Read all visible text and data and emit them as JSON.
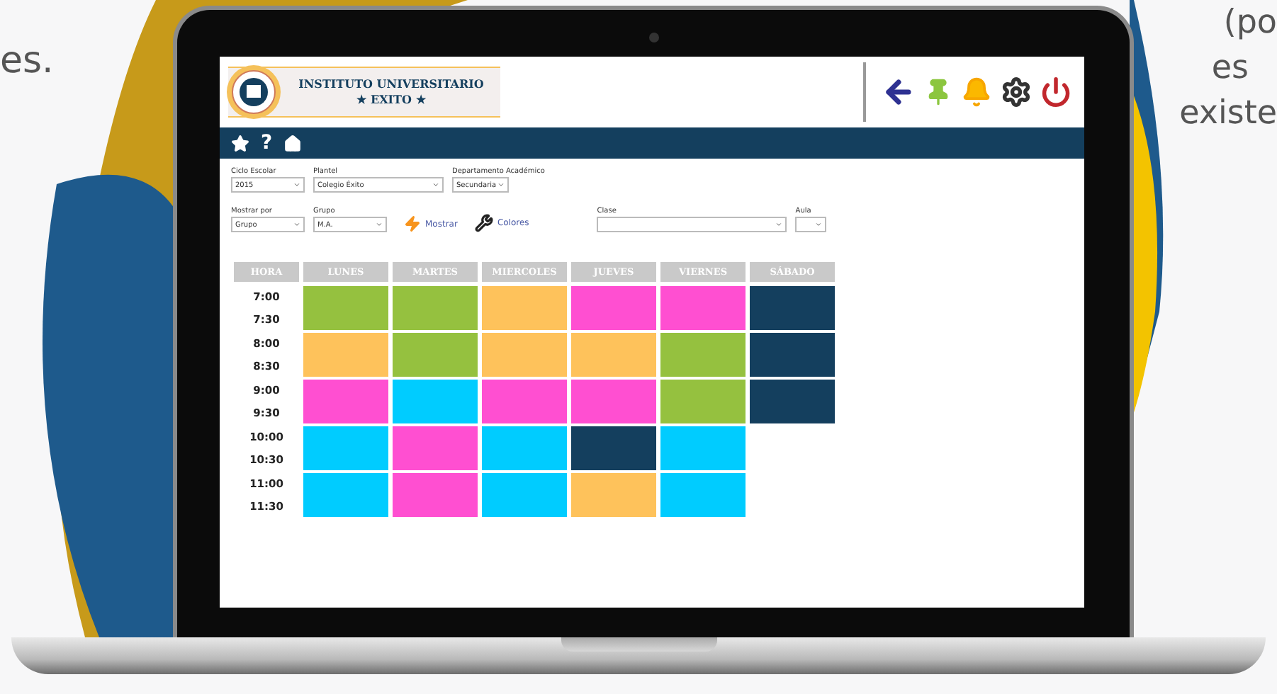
{
  "side_texts": {
    "left": "es.",
    "right": [
      "(po",
      "es",
      "existe"
    ]
  },
  "header": {
    "logo_line1": "INSTITUTO UNIVERSITARIO",
    "logo_line2": "★ EXITO ★"
  },
  "nav": {
    "help": "?"
  },
  "filters": [
    {
      "label": "Ciclo Escolar",
      "value": "2015"
    },
    {
      "label": "Plantel",
      "value": "Colegio Éxito"
    },
    {
      "label": "Departamento Académico",
      "value": "Secundaria"
    }
  ],
  "filters2": [
    {
      "label": "Mostrar por",
      "value": "Grupo"
    },
    {
      "label": "Grupo",
      "value": "M.A."
    }
  ],
  "actions": {
    "show": "Mostrar",
    "colors": "Colores"
  },
  "filters3": [
    {
      "label": "Clase"
    },
    {
      "label": "Aula"
    }
  ],
  "schedule": {
    "columns": [
      "HORA",
      "LUNES",
      "MARTES",
      "MIERCOLES",
      "JUEVES",
      "VIERNES",
      "SÁBADO"
    ],
    "rows": [
      {
        "times": [
          "7:00",
          "7:30"
        ],
        "cells": [
          {
            "color": "#95c13f"
          },
          {
            "color": "#95c13f"
          },
          {
            "color": "#fec25b"
          },
          {
            "color": "#ff4fd1"
          },
          {
            "color": "#ff4fd1"
          },
          {
            "color": "#143f5e"
          }
        ]
      },
      {
        "times": [
          "8:00",
          "8:30"
        ],
        "cells": [
          {
            "color": "#fec25b"
          },
          {
            "color": "#95c13f"
          },
          {
            "color": "#fec25b"
          },
          {
            "color": "#fec25b"
          },
          {
            "color": "#95c13f"
          },
          {
            "color": "#143f5e"
          }
        ]
      },
      {
        "times": [
          "9:00",
          "9:30"
        ],
        "cells": [
          {
            "color": "#ff4fd1"
          },
          {
            "color": "#00ccff"
          },
          {
            "color": "#ff4fd1"
          },
          {
            "color": "#ff4fd1"
          },
          {
            "color": "#95c13f"
          },
          {
            "color": "#143f5e"
          }
        ]
      },
      {
        "times": [
          "10:00",
          "10:30"
        ],
        "cells": [
          {
            "color": "#00ccff"
          },
          {
            "color": "#ff4fd1"
          },
          {
            "color": "#00ccff"
          },
          {
            "color": "#143f5e"
          },
          {
            "color": "#00ccff"
          },
          {}
        ]
      },
      {
        "times": [
          "11:00",
          "11:30"
        ],
        "cells": [
          {
            "color": "#00ccff"
          },
          {
            "color": "#ff4fd1"
          },
          {
            "color": "#00ccff"
          },
          {
            "color": "#fec25b"
          },
          {
            "color": "#00ccff"
          },
          {}
        ]
      }
    ]
  }
}
